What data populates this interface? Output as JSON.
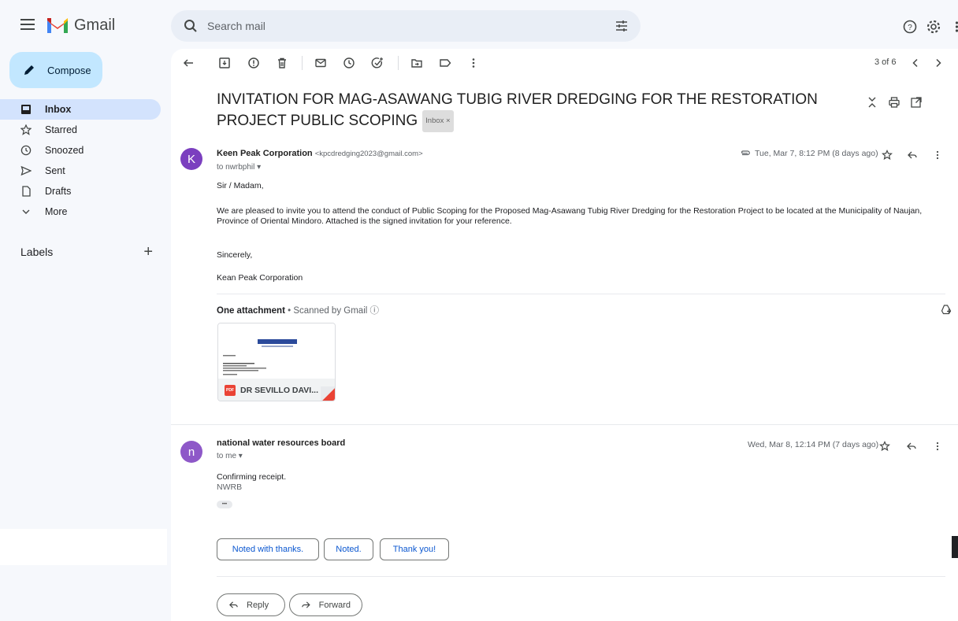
{
  "app": {
    "name": "Gmail"
  },
  "search": {
    "placeholder": "Search mail"
  },
  "sidebar": {
    "compose_label": "Compose",
    "items": [
      {
        "label": "Inbox",
        "icon": "inbox-icon"
      },
      {
        "label": "Starred",
        "icon": "star-icon"
      },
      {
        "label": "Snoozed",
        "icon": "clock-icon"
      },
      {
        "label": "Sent",
        "icon": "send-icon"
      },
      {
        "label": "Drafts",
        "icon": "draft-icon"
      },
      {
        "label": "More",
        "icon": "chevron-down-icon"
      }
    ],
    "labels_heading": "Labels"
  },
  "toolbar": {
    "page_count": "3 of 6"
  },
  "thread": {
    "subject": "INVITATION FOR MAG-ASAWANG TUBIG RIVER DREDGING FOR THE RESTORATION PROJECT PUBLIC SCOPING",
    "label_chip": "Inbox ×"
  },
  "message1": {
    "avatar_letter": "K",
    "avatar_color": "#7b3fbf",
    "sender_name": "Keen Peak Corporation",
    "sender_email": "<kpcdredging2023@gmail.com>",
    "to": "to nwrbphil ▾",
    "date": "Tue, Mar 7, 8:12 PM (8 days ago)",
    "greeting": "Sir / Madam,",
    "body": "We are pleased to invite you to attend the conduct of Public Scoping for  the Proposed Mag-Asawang Tubig River Dredging for the Restoration Project to be located at the Municipality of Naujan, Province of Oriental Mindoro. Attached is the signed invitation for your reference.",
    "closing": "Sincerely,",
    "signature": "Kean Peak Corporation",
    "attach_heading": "One attachment",
    "attach_scanned": " •  Scanned by Gmail ⓘ",
    "attach_name": "DR SEVILLO DAVI..."
  },
  "message2": {
    "avatar_letter": "n",
    "avatar_color": "#8e58c8",
    "sender_name": "national water resources board",
    "to": "to me ▾",
    "date": "Wed, Mar 8, 12:14 PM (7 days ago)",
    "body_line1": "Confirming receipt.",
    "body_line2": "NWRB",
    "ellipsis": "•••"
  },
  "smart_replies": [
    "Noted with thanks.",
    "Noted.",
    "Thank you!"
  ],
  "actions": {
    "reply": "Reply",
    "forward": "Forward"
  }
}
